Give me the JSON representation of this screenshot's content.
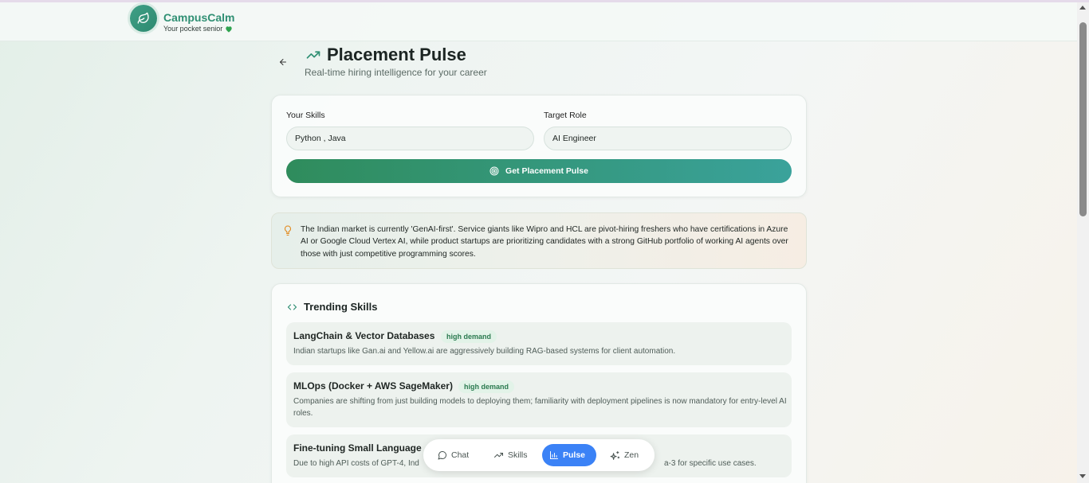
{
  "app": {
    "brand_name": "CampusCalm",
    "tagline": "Your pocket senior",
    "accent": "#2f8f73"
  },
  "page": {
    "title": "Placement Pulse",
    "subtitle": "Real-time hiring intelligence for your career"
  },
  "form": {
    "skills_label": "Your Skills",
    "skills_value": "Python , Java",
    "role_label": "Target Role",
    "role_value": "AI Engineer",
    "submit_label": "Get Placement Pulse"
  },
  "insight": {
    "text": "The Indian market is currently 'GenAI-first'. Service giants like Wipro and HCL are pivot-hiring freshers who have certifications in Azure AI or Google Cloud Vertex AI, while product startups are prioritizing candidates with a strong GitHub portfolio of working AI agents over those with just competitive programming scores."
  },
  "trending": {
    "title": "Trending Skills",
    "items": [
      {
        "name": "LangChain & Vector Databases",
        "badge": "high demand",
        "description": "Indian startups like Gan.ai and Yellow.ai are aggressively building RAG-based systems for client automation."
      },
      {
        "name": "MLOps (Docker + AWS SageMaker)",
        "badge": "high demand",
        "description": "Companies are shifting from just building models to deploying them; familiarity with deployment pipelines is now mandatory for entry-level AI roles."
      },
      {
        "name": "Fine-tuning Small Language",
        "desc_left": "Due to high API costs of GPT-4, Ind",
        "desc_right": "a-3 for specific use cases."
      }
    ]
  },
  "nav": {
    "items": [
      {
        "label": "Chat",
        "icon": "chat-icon"
      },
      {
        "label": "Skills",
        "icon": "trending-icon"
      },
      {
        "label": "Pulse",
        "icon": "bar-chart-icon",
        "active": true
      },
      {
        "label": "Zen",
        "icon": "sparkles-icon"
      }
    ],
    "active_color": "#3b82f6"
  }
}
